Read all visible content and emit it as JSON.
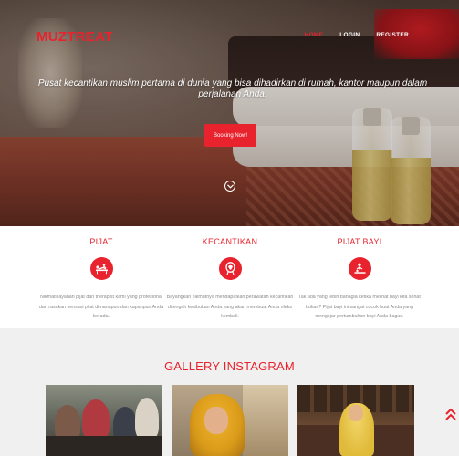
{
  "nav": {
    "brand": "MUZTREAT",
    "items": [
      {
        "label": "HOME",
        "active": true
      },
      {
        "label": "LOGIN",
        "active": false
      },
      {
        "label": "REGISTER",
        "active": false
      }
    ]
  },
  "hero": {
    "tagline": "Pusat kecantikan muslim pertama di dunia yang bisa dihadirkan di rumah, kantor maupun dalam perjalanan Anda.",
    "cta_label": "Booking Now!"
  },
  "services": [
    {
      "title": "PIJAT",
      "icon": "massage-icon",
      "desc": "Nikmati layanan pijat dan therapist kami yang profesional dan rasakan sensasi pijat dimanapun dan kapanpun Anda berada."
    },
    {
      "title": "KECANTIKAN",
      "icon": "beauty-icon",
      "desc": "Bayangkan nikmatnya mendapatkan perawatan kecantikan ditengah kesibukan Anda yang akan membuat Anda rileks kembali."
    },
    {
      "title": "PIJAT BAYI",
      "icon": "baby-massage-icon",
      "desc": "Tak ada yang lebih bahagia ketika melihat bayi kita sehat bukan? Pijat bayi ini sangat cocok buat Anda yang mengejar pertumbuhan bayi Anda bagus."
    }
  ],
  "gallery": {
    "title": "GALLERY INSTAGRAM"
  },
  "colors": {
    "accent": "#e8232d"
  }
}
